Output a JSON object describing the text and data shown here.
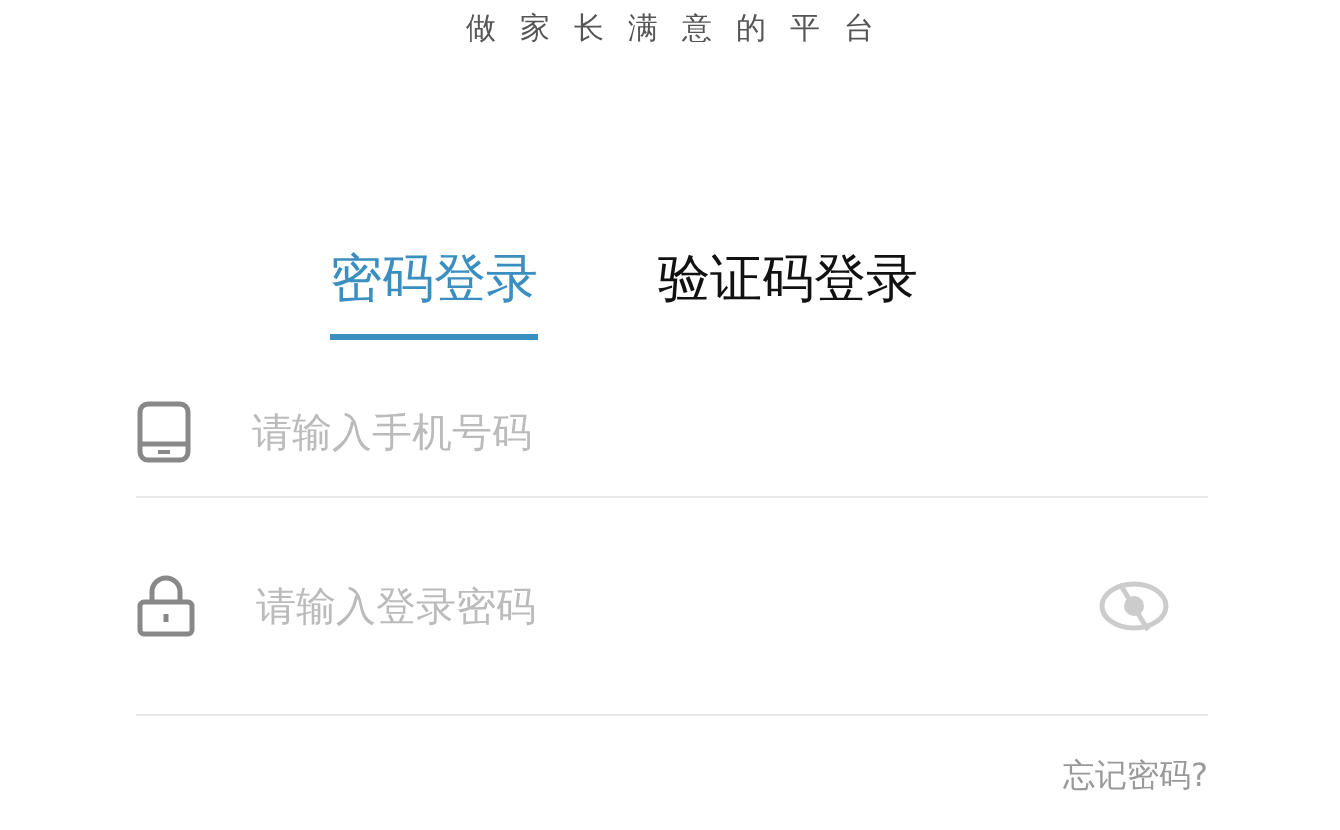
{
  "tagline": "做家长满意的平台",
  "tabs": [
    {
      "label": "密码登录",
      "selected": true
    },
    {
      "label": "验证码登录",
      "selected": false
    }
  ],
  "fields": [
    {
      "kind": "phone",
      "placeholder": "请输入手机号码"
    },
    {
      "kind": "password",
      "placeholder": "请输入登录密码",
      "reveal": false
    }
  ],
  "forgot_link": "忘记密码?"
}
